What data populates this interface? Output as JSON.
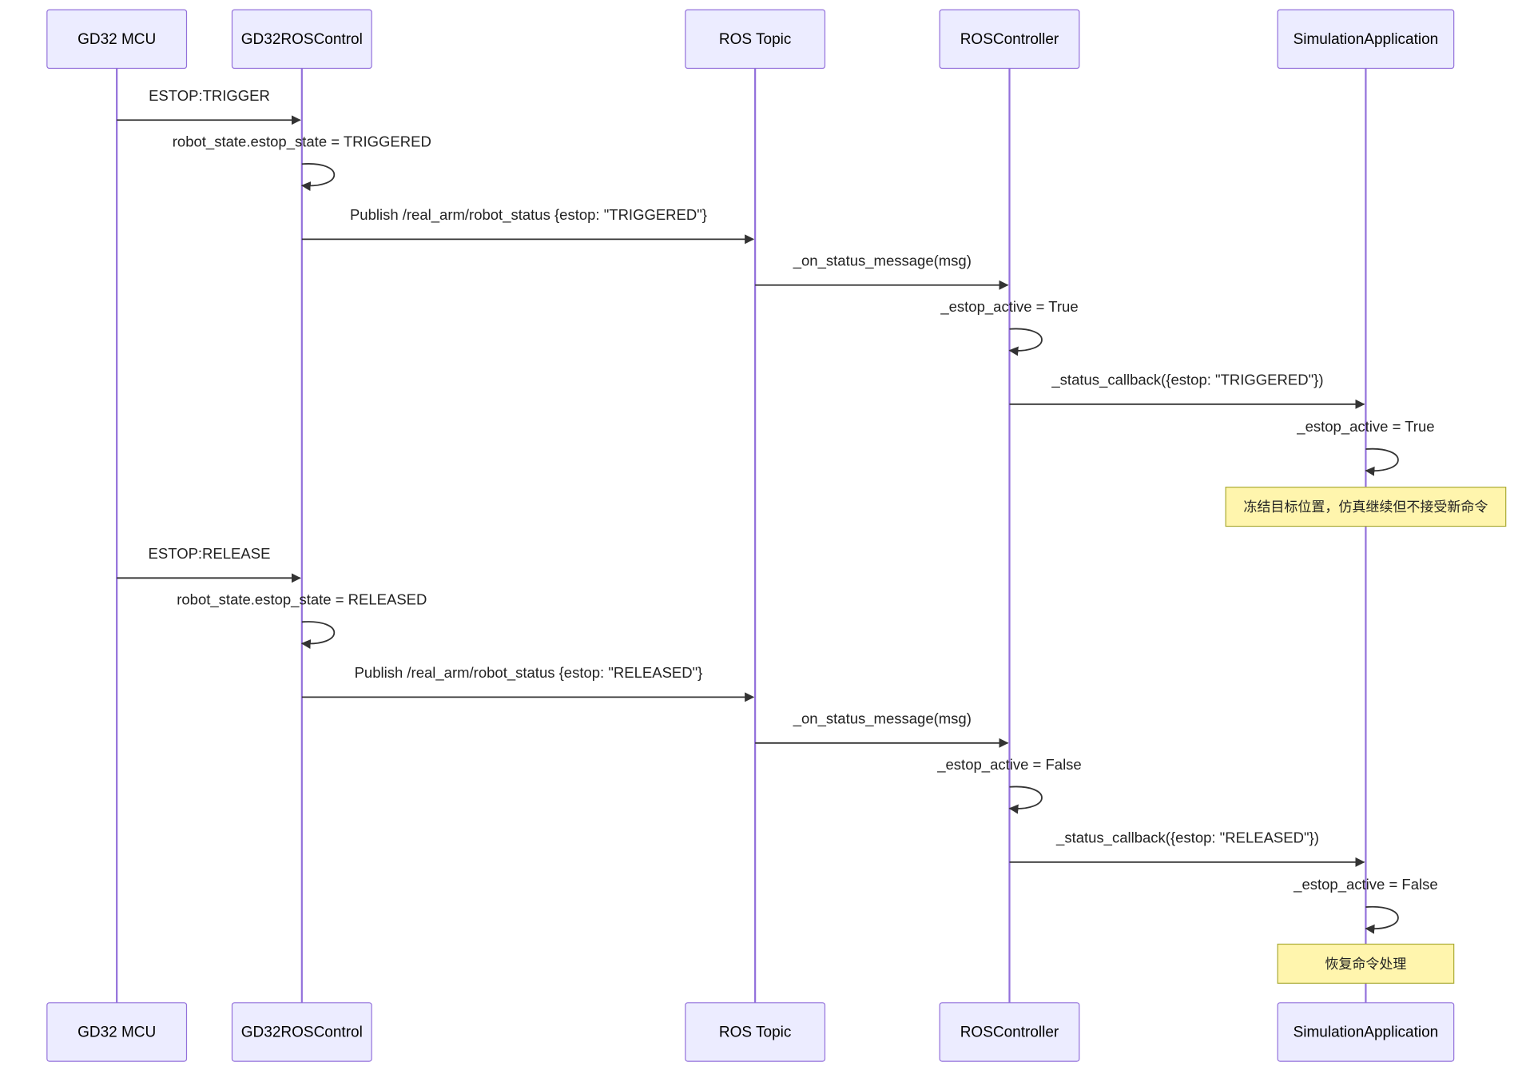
{
  "actors": [
    {
      "id": "gd32",
      "label": "GD32 MCU"
    },
    {
      "id": "roscontrol",
      "label": "GD32ROSControl"
    },
    {
      "id": "topic",
      "label": "ROS Topic"
    },
    {
      "id": "controller",
      "label": "ROSController"
    },
    {
      "id": "sim",
      "label": "SimulationApplication"
    }
  ],
  "messages": [
    {
      "from": "gd32",
      "to": "roscontrol",
      "label": "ESTOP:TRIGGER"
    },
    {
      "from": "roscontrol",
      "to": "roscontrol",
      "label": "robot_state.estop_state = TRIGGERED"
    },
    {
      "from": "roscontrol",
      "to": "topic",
      "label": "Publish /real_arm/robot_status {estop: \"TRIGGERED\"}"
    },
    {
      "from": "topic",
      "to": "controller",
      "label": "_on_status_message(msg)"
    },
    {
      "from": "controller",
      "to": "controller",
      "label": "_estop_active = True"
    },
    {
      "from": "controller",
      "to": "sim",
      "label": "_status_callback({estop: \"TRIGGERED\"})"
    },
    {
      "from": "sim",
      "to": "sim",
      "label": "_estop_active = True"
    },
    {
      "note": "sim",
      "label": "冻结目标位置，仿真继续但不接受新命令"
    },
    {
      "from": "gd32",
      "to": "roscontrol",
      "label": "ESTOP:RELEASE"
    },
    {
      "from": "roscontrol",
      "to": "roscontrol",
      "label": "robot_state.estop_state = RELEASED"
    },
    {
      "from": "roscontrol",
      "to": "topic",
      "label": "Publish /real_arm/robot_status {estop: \"RELEASED\"}"
    },
    {
      "from": "topic",
      "to": "controller",
      "label": "_on_status_message(msg)"
    },
    {
      "from": "controller",
      "to": "controller",
      "label": "_estop_active = False"
    },
    {
      "from": "controller",
      "to": "sim",
      "label": "_status_callback({estop: \"RELEASED\"})"
    },
    {
      "from": "sim",
      "to": "sim",
      "label": "_estop_active = False"
    },
    {
      "note": "sim",
      "label": "恢复命令处理"
    }
  ],
  "colors": {
    "actor_fill": "#ececff",
    "actor_border": "#9370db",
    "lifeline": "#9370db",
    "arrow": "#333333",
    "note_fill": "#fff5ad",
    "note_border": "#aaaa33"
  }
}
